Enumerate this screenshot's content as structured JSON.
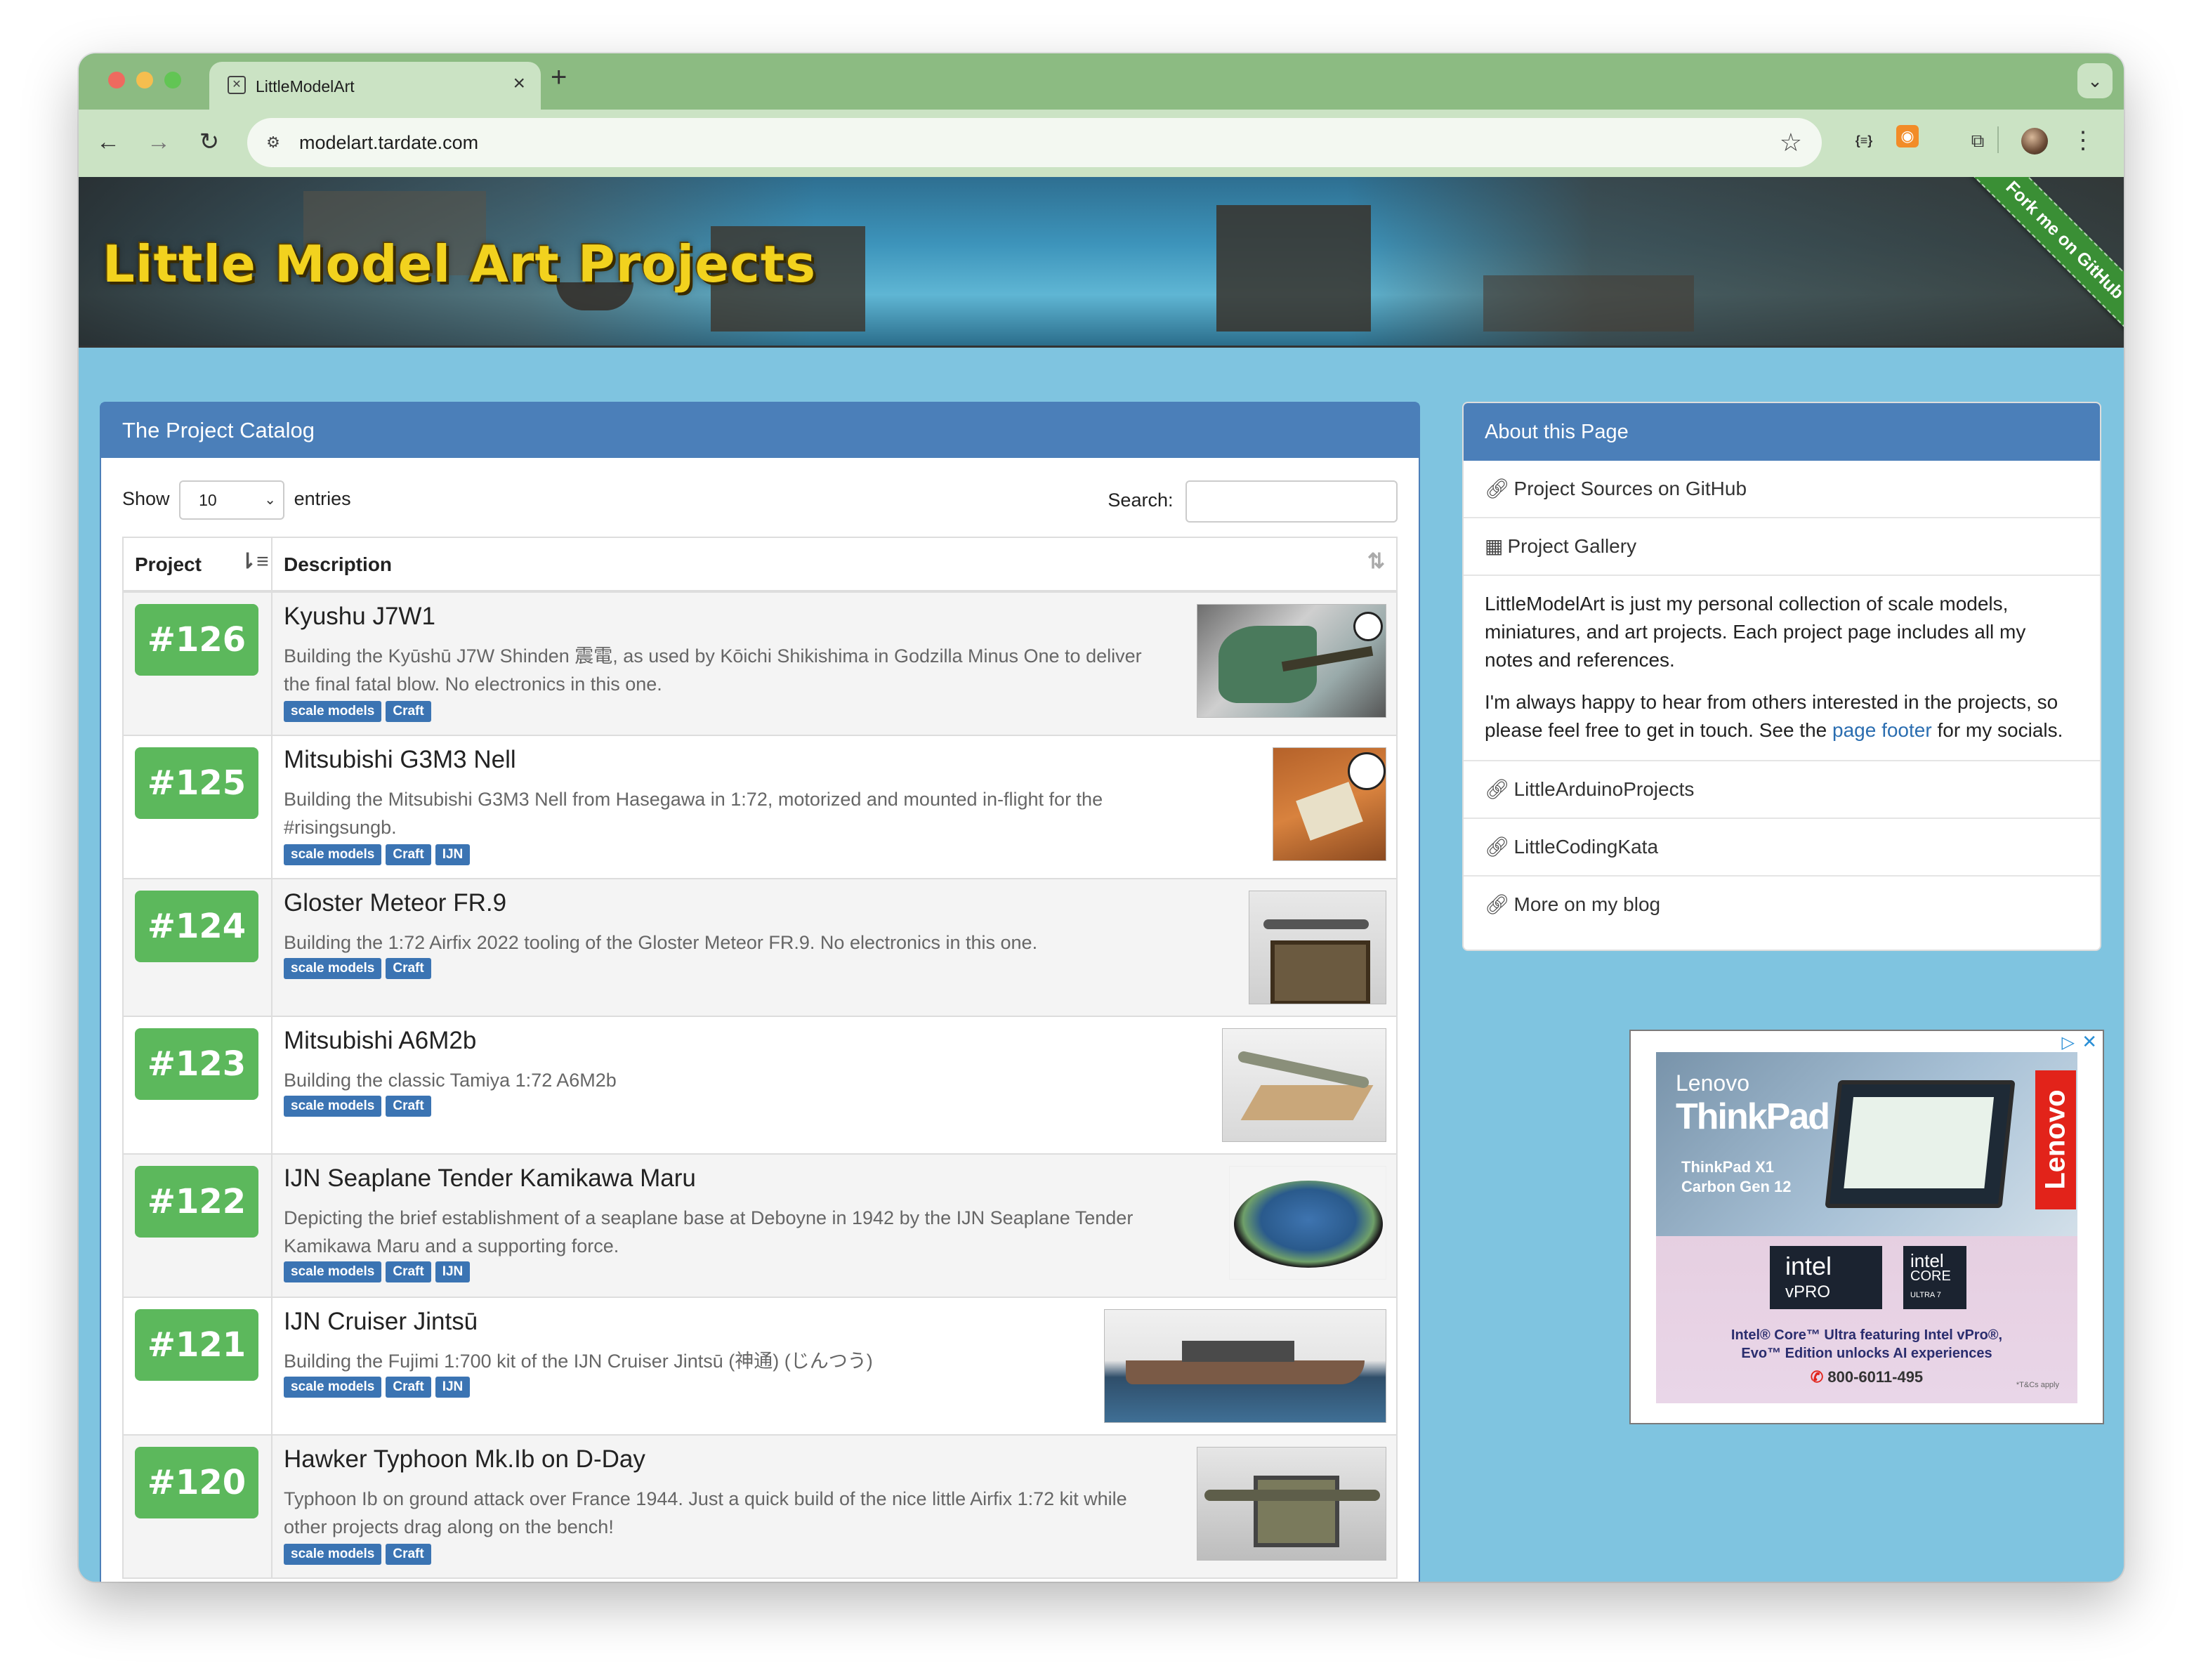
{
  "browser": {
    "tab_title": "LittleModelArt",
    "tab_close": "×",
    "new_tab": "+",
    "tab_menu": "⌄",
    "url": "modelart.tardate.com",
    "nav": {
      "back": "←",
      "forward": "→",
      "reload": "↻"
    },
    "icons": [
      "site-info-icon",
      "star-icon",
      "json-viewer-icon",
      "rss-icon",
      "extensions-icon",
      "profile-avatar",
      "kebab-menu-icon"
    ]
  },
  "banner": {
    "title": "Little Model Art Projects",
    "ribbon": "Fork me on GitHub"
  },
  "catalog": {
    "heading": "The Project Catalog",
    "show_label": "Show",
    "entries_value": "10",
    "entries_label": "entries",
    "search_label": "Search:",
    "search_value": "",
    "col_project": "Project",
    "col_description": "Description",
    "rows": [
      {
        "number": "#126",
        "title": "Kyushu J7W1",
        "desc_line1": "Building the Kyūshū J7W Shinden 震電, as used by Kōichi Shikishima in Godzilla Minus One to deliver",
        "desc_line2": "the final fatal blow. No electronics in this one.",
        "tags": [
          "scale models",
          "Craft"
        ]
      },
      {
        "number": "#125",
        "title": "Mitsubishi G3M3 Nell",
        "desc_line1": "Building the Mitsubishi G3M3 Nell from Hasegawa in 1:72, motorized and mounted in-flight for the",
        "desc_line2": "#risingsungb.",
        "tags": [
          "scale models",
          "Craft",
          "IJN"
        ]
      },
      {
        "number": "#124",
        "title": "Gloster Meteor FR.9",
        "desc_line1": "Building the 1:72 Airfix 2022 tooling of the Gloster Meteor FR.9. No electronics in this one.",
        "desc_line2": "",
        "tags": [
          "scale models",
          "Craft"
        ]
      },
      {
        "number": "#123",
        "title": "Mitsubishi A6M2b",
        "desc_line1": "Building the classic Tamiya 1:72 A6M2b",
        "desc_line2": "",
        "tags": [
          "scale models",
          "Craft"
        ]
      },
      {
        "number": "#122",
        "title": "IJN Seaplane Tender Kamikawa Maru",
        "desc_line1": "Depicting the brief establishment of a seaplane base at Deboyne in 1942 by the IJN Seaplane Tender",
        "desc_line2": "Kamikawa Maru and a supporting force.",
        "tags": [
          "scale models",
          "Craft",
          "IJN"
        ]
      },
      {
        "number": "#121",
        "title": "IJN Cruiser Jintsū",
        "desc_line1": "Building the Fujimi 1:700 kit of the IJN Cruiser Jintsū (神通) (じんつう)",
        "desc_line2": "",
        "tags": [
          "scale models",
          "Craft",
          "IJN"
        ]
      },
      {
        "number": "#120",
        "title": "Hawker Typhoon Mk.Ib on D-Day",
        "desc_line1": "Typhoon Ib on ground attack over France 1944. Just a quick build of the nice little Airfix 1:72 kit while",
        "desc_line2": "other projects drag along on the bench!",
        "tags": [
          "scale models",
          "Craft"
        ]
      }
    ]
  },
  "about": {
    "heading": "About this Page",
    "links_top": [
      "Project Sources on GitHub",
      "Project Gallery"
    ],
    "para1": "LittleModelArt is just my personal collection of scale models, miniatures, and art projects. Each project page includes all my notes and references.",
    "para2_before": "I'm always happy to hear from others interested in the projects, so please feel free to get in touch. See the ",
    "para2_link": "page footer",
    "para2_after": " for my socials.",
    "links_bottom": [
      "LittleArduinoProjects",
      "LittleCodingKata",
      "More on my blog"
    ]
  },
  "ad": {
    "brand": "Lenovo",
    "product": "ThinkPad",
    "model_line1": "ThinkPad X1",
    "model_line2": "Carbon Gen 12",
    "side_brand": "Lenovo",
    "intel1_top": "intel",
    "intel1_bottom": "vPRO",
    "intel2_top": "intel",
    "intel2_mid": "CORE",
    "intel2_bottom": "ULTRA 7",
    "copy_line1": "Intel® Core™ Ultra featuring Intel vPro®,",
    "copy_line2": "Evo™ Edition unlocks AI experiences",
    "phone": "800-6011-495",
    "tc": "*T&Cs apply"
  }
}
